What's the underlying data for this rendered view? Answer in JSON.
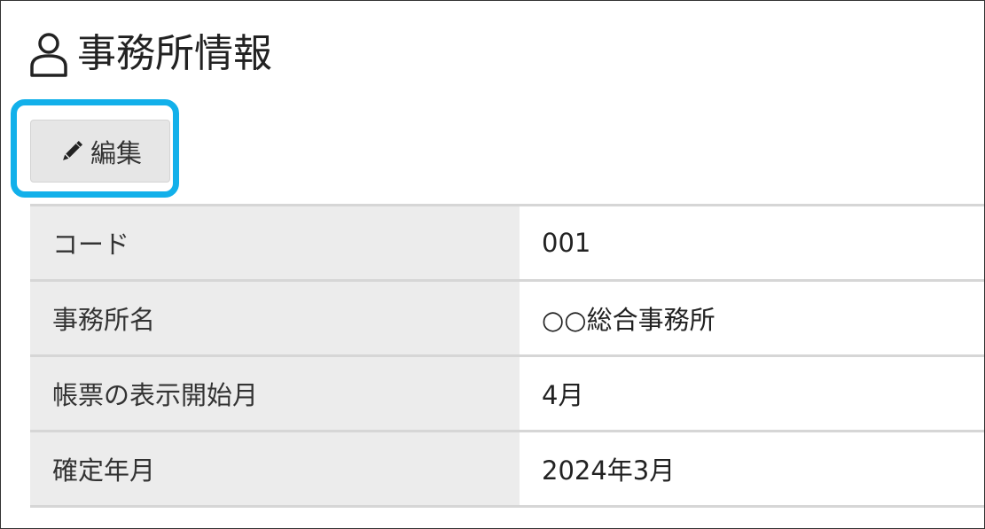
{
  "header": {
    "title": "事務所情報",
    "icon": "user-icon"
  },
  "toolbar": {
    "edit_label": "編集",
    "edit_icon": "pencil-icon",
    "highlight_color": "#12b0ea"
  },
  "info": {
    "rows": [
      {
        "label": "コード",
        "value": "001"
      },
      {
        "label": "事務所名",
        "value": "○○総合事務所"
      },
      {
        "label": "帳票の表示開始月",
        "value": "4月"
      },
      {
        "label": "確定年月",
        "value": "2024年3月"
      }
    ]
  }
}
